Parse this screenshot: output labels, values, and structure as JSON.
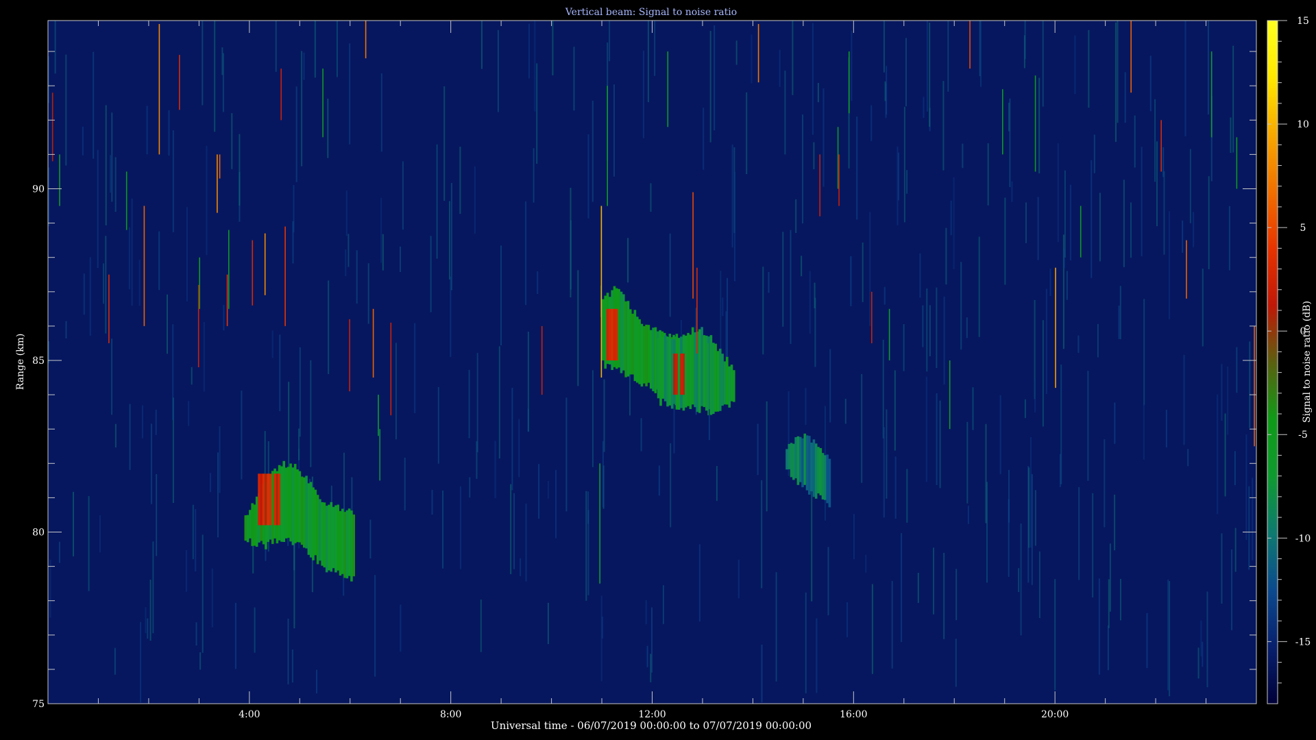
{
  "chart_data": {
    "type": "heatmap",
    "title": "Vertical beam: Signal to noise ratio",
    "xlabel": "Universal time - 06/07/2019 00:00:00 to 07/07/2019 00:00:00",
    "ylabel": "Range (km)",
    "colorbar_label": "Signal to noise ratio (dB)",
    "xlim": [
      0,
      24
    ],
    "ylim": [
      75,
      94.9
    ],
    "clim": [
      -18,
      15
    ],
    "x_ticks": [
      {
        "value": 4,
        "label": "4:00"
      },
      {
        "value": 8,
        "label": "8:00"
      },
      {
        "value": 12,
        "label": "12:00"
      },
      {
        "value": 16,
        "label": "16:00"
      },
      {
        "value": 20,
        "label": "20:00"
      }
    ],
    "y_ticks": [
      {
        "value": 75,
        "label": "75"
      },
      {
        "value": 80,
        "label": "80"
      },
      {
        "value": 85,
        "label": "85"
      },
      {
        "value": 90,
        "label": "90"
      }
    ],
    "colorbar_ticks": [
      {
        "value": 15,
        "label": "15"
      },
      {
        "value": 10,
        "label": "10"
      },
      {
        "value": 5,
        "label": "5"
      },
      {
        "value": 0,
        "label": "0"
      },
      {
        "value": -5,
        "label": "-5"
      },
      {
        "value": -10,
        "label": "-10"
      },
      {
        "value": -15,
        "label": "-15"
      }
    ],
    "colormap": [
      "#000038",
      "#08206e",
      "#0c4a8e",
      "#0e7a70",
      "#0f9a30",
      "#109a18",
      "#5c6010",
      "#c01808",
      "#e83400",
      "#f07000",
      "#f8a800",
      "#ffe800",
      "#ffff20"
    ],
    "background_snr": -16,
    "regions": [
      {
        "name": "echo-4h",
        "t0": 3.9,
        "t1": 6.05,
        "r_bottom": [
          79.7,
          79.7,
          79.6,
          79.8,
          79.8,
          79.6,
          79.4,
          79.0,
          78.9,
          78.7,
          78.6
        ],
        "r_top": [
          80.5,
          81.0,
          81.5,
          81.9,
          82.0,
          81.8,
          81.4,
          80.9,
          80.8,
          80.7,
          80.5
        ],
        "snr": -6,
        "core": {
          "t0": 4.1,
          "t1": 4.6,
          "r0": 80.2,
          "r1": 81.7,
          "snr": 2
        }
      },
      {
        "name": "echo-11h",
        "t0": 11.0,
        "t1": 12.45,
        "r_bottom": [
          84.9,
          84.8,
          84.6,
          84.4,
          84.2,
          84.0,
          83.8
        ],
        "r_top": [
          86.8,
          87.1,
          86.7,
          86.2,
          85.9,
          85.8,
          85.6
        ],
        "snr": -6,
        "core": {
          "t0": 11.05,
          "t1": 11.4,
          "r0": 85.0,
          "r1": 86.5,
          "snr": 2
        }
      },
      {
        "name": "echo-12h",
        "t0": 12.1,
        "t1": 13.6,
        "r_bottom": [
          83.8,
          83.7,
          83.6,
          83.6,
          83.5,
          83.6,
          83.8
        ],
        "r_top": [
          85.6,
          85.7,
          85.8,
          85.9,
          85.8,
          85.2,
          84.8
        ],
        "snr": -7,
        "core": {
          "t0": 12.35,
          "t1": 12.6,
          "r0": 84.0,
          "r1": 85.2,
          "snr": 2
        }
      },
      {
        "name": "echo-15h",
        "t0": 14.65,
        "t1": 15.5,
        "r_bottom": [
          81.8,
          81.5,
          81.2,
          81.0,
          80.7
        ],
        "r_top": [
          82.4,
          82.7,
          82.8,
          82.5,
          82.2
        ],
        "snr": -10
      }
    ],
    "streaks": [
      {
        "t": 0.08,
        "r0": 90.8,
        "r1": 92.8,
        "snr": 1
      },
      {
        "t": 0.22,
        "r0": 89.5,
        "r1": 91.0,
        "snr": -6
      },
      {
        "t": 1.2,
        "r0": 85.5,
        "r1": 87.5,
        "snr": 3
      },
      {
        "t": 1.55,
        "r0": 88.8,
        "r1": 90.5,
        "snr": -5
      },
      {
        "t": 1.9,
        "r0": 86.0,
        "r1": 89.5,
        "snr": 6
      },
      {
        "t": 2.2,
        "r0": 91.0,
        "r1": 94.8,
        "snr": 8
      },
      {
        "t": 2.6,
        "r0": 92.3,
        "r1": 93.9,
        "snr": 3
      },
      {
        "t": 2.98,
        "r0": 84.8,
        "r1": 87.2,
        "snr": 2
      },
      {
        "t": 3.0,
        "r0": 86.5,
        "r1": 88.0,
        "snr": -6
      },
      {
        "t": 3.35,
        "r0": 89.3,
        "r1": 91.0,
        "snr": 8
      },
      {
        "t": 3.4,
        "r0": 90.3,
        "r1": 91.0,
        "snr": 6
      },
      {
        "t": 3.55,
        "r0": 86.0,
        "r1": 87.5,
        "snr": 4
      },
      {
        "t": 3.58,
        "r0": 86.5,
        "r1": 88.8,
        "snr": -6
      },
      {
        "t": 4.05,
        "r0": 86.6,
        "r1": 88.5,
        "snr": 3
      },
      {
        "t": 4.3,
        "r0": 86.9,
        "r1": 88.7,
        "snr": 8
      },
      {
        "t": 4.7,
        "r0": 86.0,
        "r1": 88.9,
        "snr": 4
      },
      {
        "t": 4.62,
        "r0": 92.0,
        "r1": 93.5,
        "snr": 2
      },
      {
        "t": 5.98,
        "r0": 84.1,
        "r1": 86.2,
        "snr": 2
      },
      {
        "t": 5.45,
        "r0": 91.5,
        "r1": 93.5,
        "snr": -6
      },
      {
        "t": 6.3,
        "r0": 93.8,
        "r1": 94.9,
        "snr": 7
      },
      {
        "t": 6.45,
        "r0": 84.5,
        "r1": 86.5,
        "snr": 6
      },
      {
        "t": 6.55,
        "r0": 82.8,
        "r1": 84.0,
        "snr": -7
      },
      {
        "t": 6.58,
        "r0": 81.5,
        "r1": 83.0,
        "snr": -8
      },
      {
        "t": 6.8,
        "r0": 83.4,
        "r1": 86.1,
        "snr": 2
      },
      {
        "t": 9.8,
        "r0": 84.0,
        "r1": 86.0,
        "snr": 2
      },
      {
        "t": 10.98,
        "r0": 84.5,
        "r1": 89.5,
        "snr": 10
      },
      {
        "t": 10.95,
        "r0": 78.5,
        "r1": 82.0,
        "snr": -7
      },
      {
        "t": 11.1,
        "r0": 89.5,
        "r1": 93.0,
        "snr": -6
      },
      {
        "t": 12.3,
        "r0": 91.8,
        "r1": 94.0,
        "snr": -6
      },
      {
        "t": 12.8,
        "r0": 86.8,
        "r1": 89.9,
        "snr": 5
      },
      {
        "t": 12.88,
        "r0": 85.2,
        "r1": 87.7,
        "snr": 3
      },
      {
        "t": 13.1,
        "r0": 83.4,
        "r1": 85.5,
        "snr": -5
      },
      {
        "t": 14.1,
        "r0": 93.1,
        "r1": 94.8,
        "snr": 7
      },
      {
        "t": 15.32,
        "r0": 89.2,
        "r1": 91.0,
        "snr": 2
      },
      {
        "t": 15.68,
        "r0": 90.0,
        "r1": 91.8,
        "snr": -6
      },
      {
        "t": 15.7,
        "r0": 89.5,
        "r1": 91.0,
        "snr": 2
      },
      {
        "t": 15.9,
        "r0": 92.2,
        "r1": 94.0,
        "snr": -6
      },
      {
        "t": 16.35,
        "r0": 85.5,
        "r1": 87.0,
        "snr": 2
      },
      {
        "t": 16.7,
        "r0": 85.0,
        "r1": 86.5,
        "snr": -7
      },
      {
        "t": 17.9,
        "r0": 83.0,
        "r1": 85.0,
        "snr": -6
      },
      {
        "t": 18.3,
        "r0": 93.5,
        "r1": 94.9,
        "snr": 5
      },
      {
        "t": 18.95,
        "r0": 91.0,
        "r1": 92.9,
        "snr": -6
      },
      {
        "t": 19.6,
        "r0": 90.5,
        "r1": 93.3,
        "snr": -5
      },
      {
        "t": 20.0,
        "r0": 84.2,
        "r1": 87.7,
        "snr": 9
      },
      {
        "t": 20.5,
        "r0": 88.0,
        "r1": 89.5,
        "snr": -6
      },
      {
        "t": 21.5,
        "r0": 92.8,
        "r1": 94.9,
        "snr": 6
      },
      {
        "t": 22.1,
        "r0": 90.5,
        "r1": 92.0,
        "snr": 3
      },
      {
        "t": 22.6,
        "r0": 86.8,
        "r1": 88.5,
        "snr": 6
      },
      {
        "t": 23.1,
        "r0": 91.5,
        "r1": 94.0,
        "snr": -7
      },
      {
        "t": 23.6,
        "r0": 90.0,
        "r1": 91.5,
        "snr": -5
      },
      {
        "t": 23.95,
        "r0": 82.5,
        "r1": 86.0,
        "snr": 6
      }
    ]
  }
}
